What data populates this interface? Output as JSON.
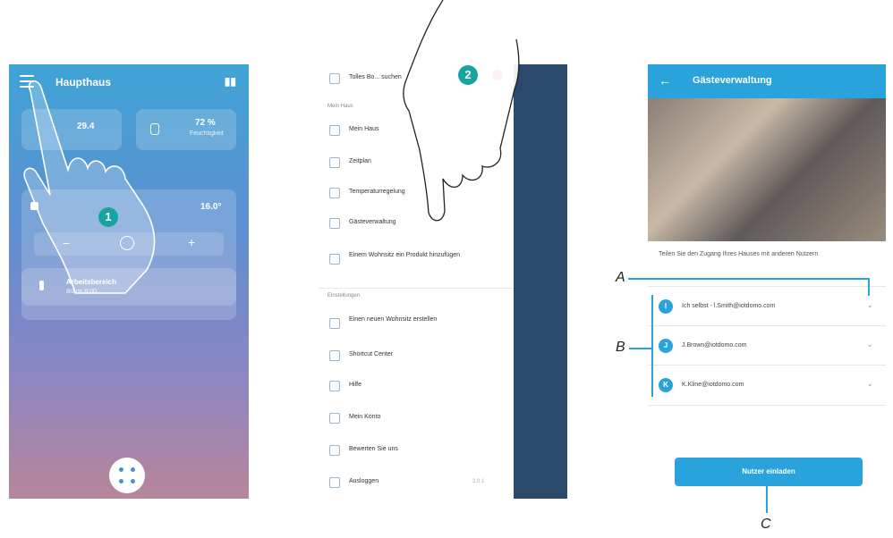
{
  "phone1": {
    "title": "Haupthaus",
    "signal_icon": "signal-icon",
    "card_temp": {
      "value": "29.4"
    },
    "card_humidity": {
      "value": "72 %",
      "sub": "Feuchtigkeit"
    },
    "control_value": "16.0°",
    "scene": {
      "title": "Arbeitsbereich",
      "sub": "Büros 8:00"
    },
    "step": "1"
  },
  "phone2": {
    "search_placeholder": "Tolles Bo... suchen",
    "section1": "Mein Haus",
    "items1": [
      "Mein Haus",
      "Zeitplan",
      "Temperaturregelung",
      "Gästeverwaltung",
      "Einem Wohnsitz ein Produkt hinzufügen"
    ],
    "section2": "Einstellungen",
    "items2": [
      "Einen neuen Wohnsitz erstellen",
      "Shortcut Center",
      "Hilfe",
      "Mein Konto",
      "Bewerten Sie uns",
      "Ausloggen"
    ],
    "version": "2.0.1",
    "step": "2"
  },
  "phone3": {
    "title": "Gästeverwaltung",
    "description": "Teilen Sie den Zugang Ihres Hauses mit anderen Nutzern",
    "users": [
      {
        "initial": "I",
        "email": "Ich selbst - l.Smith@iotdomo.com"
      },
      {
        "initial": "J",
        "email": "J.Brown@iotdomo.com"
      },
      {
        "initial": "K",
        "email": "K.Kline@iotdomo.com"
      }
    ],
    "invite_button": "Nutzer einladen"
  },
  "callouts": {
    "a": "A",
    "b": "B",
    "c": "C"
  }
}
